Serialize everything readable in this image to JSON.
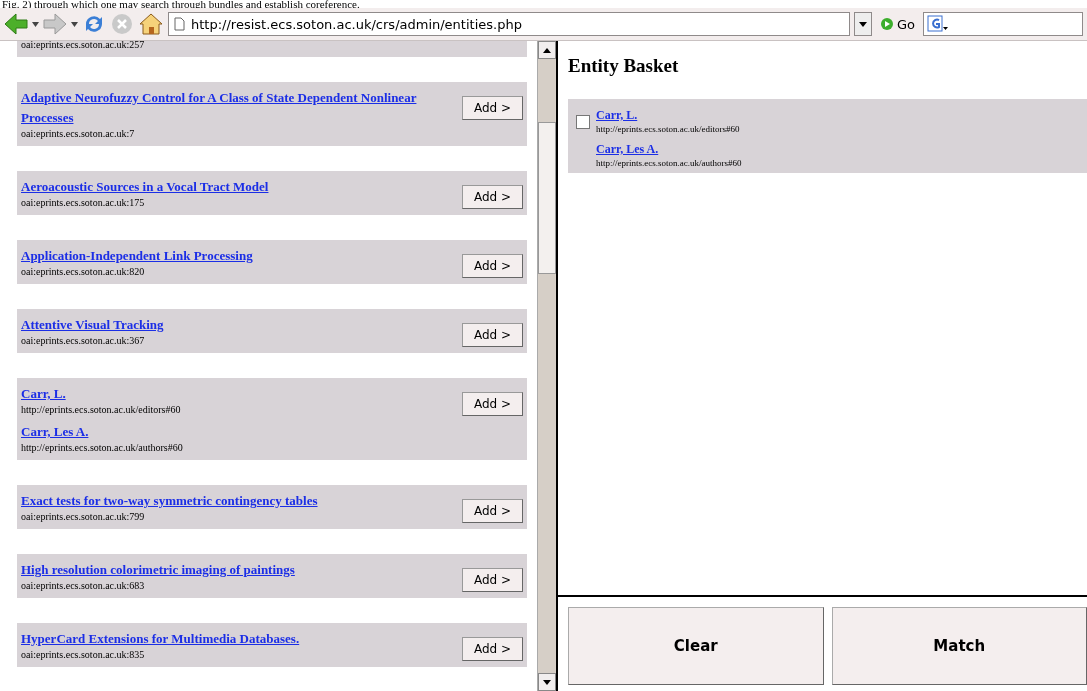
{
  "caption": "Fig. 2) through which one may search through bundles and establish coreference.",
  "toolbar": {
    "url": "http://resist.ecs.soton.ac.uk/crs/admin/entities.php",
    "go": "Go"
  },
  "results": [
    {
      "entries": [
        {
          "id": "oai:eprints.ecs.soton.ac.uk:257"
        }
      ]
    },
    {
      "entries": [
        {
          "title": "Adaptive Neurofuzzy Control for A Class of State Dependent Nonlinear Processes",
          "id": "oai:eprints.ecs.soton.ac.uk:7"
        }
      ],
      "add_button": "Add >"
    },
    {
      "entries": [
        {
          "title": "Aeroacoustic Sources in a Vocal Tract Model",
          "id": "oai:eprints.ecs.soton.ac.uk:175"
        }
      ],
      "add_button": "Add >"
    },
    {
      "entries": [
        {
          "title": "Application-Independent Link Processing",
          "id": "oai:eprints.ecs.soton.ac.uk:820"
        }
      ],
      "add_button": "Add >"
    },
    {
      "entries": [
        {
          "title": "Attentive Visual Tracking",
          "id": "oai:eprints.ecs.soton.ac.uk:367"
        }
      ],
      "add_button": "Add >"
    },
    {
      "entries": [
        {
          "title": "Carr, L.",
          "id": "http://eprints.ecs.soton.ac.uk/editors#60"
        },
        {
          "title": "Carr, Les A.",
          "id": "http://eprints.ecs.soton.ac.uk/authors#60"
        }
      ],
      "add_button": "Add >"
    },
    {
      "entries": [
        {
          "title": "Exact tests for two-way symmetric contingency tables",
          "id": "oai:eprints.ecs.soton.ac.uk:799"
        }
      ],
      "add_button": "Add >"
    },
    {
      "entries": [
        {
          "title": "High resolution colorimetric imaging of paintings",
          "id": "oai:eprints.ecs.soton.ac.uk:683"
        }
      ],
      "add_button": "Add >"
    },
    {
      "entries": [
        {
          "title": "HyperCard Extensions for Multimedia Databases.",
          "id": "oai:eprints.ecs.soton.ac.uk:835"
        }
      ],
      "add_button": "Add >"
    }
  ],
  "basket": {
    "title": "Entity Basket",
    "groups": [
      {
        "checked": false,
        "entries": [
          {
            "title": "Carr, L.",
            "id": "http://eprints.ecs.soton.ac.uk/editors#60"
          },
          {
            "title": "Carr, Les A.",
            "id": "http://eprints.ecs.soton.ac.uk/authors#60"
          }
        ]
      }
    ]
  },
  "buttons": [
    "Clear",
    "Match"
  ]
}
